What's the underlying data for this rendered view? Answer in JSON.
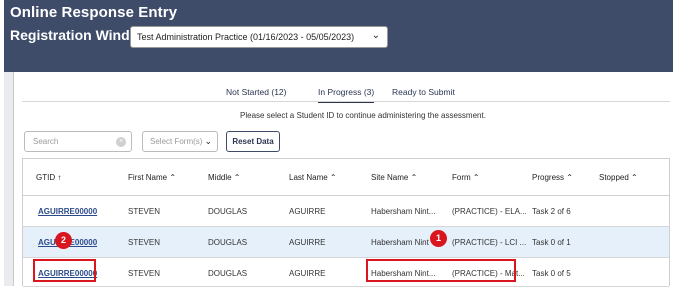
{
  "app": {
    "title": "Online Response Entry",
    "registration_label": "Registration Window",
    "registration_value": "Test Administration Practice (01/16/2023 - 05/05/2023)"
  },
  "tabs": [
    {
      "label": "Not Started",
      "count": "(12)"
    },
    {
      "label": "In Progress",
      "count": "(3)"
    },
    {
      "label": "Ready to Submit",
      "count": ""
    }
  ],
  "instruction": "Please select a Student ID to continue administering the assessment.",
  "filters": {
    "search_placeholder": "Search",
    "form_placeholder": "Select Form(s)",
    "reset_label": "Reset Data"
  },
  "table": {
    "headers": [
      "GTID ↑",
      "First Name ⌃",
      "Middle ⌃",
      "Last Name ⌃",
      "Site Name ⌃",
      "Form ⌃",
      "Progress ⌃",
      "Stopped ⌃"
    ],
    "rows": [
      [
        "AGUIRRE00000",
        "STEVEN",
        "DOUGLAS",
        "AGUIRRE",
        "Habersham Nint...",
        "(PRACTICE) - ELA...",
        "Task 2 of 6",
        ""
      ],
      [
        "AGUIRRE00000",
        "STEVEN",
        "DOUGLAS",
        "AGUIRRE",
        "Habersham Nint",
        "(PRACTICE) - LCI ...",
        "Task 0 of 1",
        ""
      ],
      [
        "AGUIRRE00000",
        "STEVEN",
        "DOUGLAS",
        "AGUIRRE",
        "Habersham Nint...",
        "(PRACTICE) - Mat...",
        "Task 0 of 5",
        ""
      ]
    ]
  },
  "callouts": [
    "1",
    "2"
  ],
  "colors": {
    "header_bg": "#3e4c6a",
    "highlight": "#d9161e",
    "row_selected": "#e6f0fa"
  }
}
